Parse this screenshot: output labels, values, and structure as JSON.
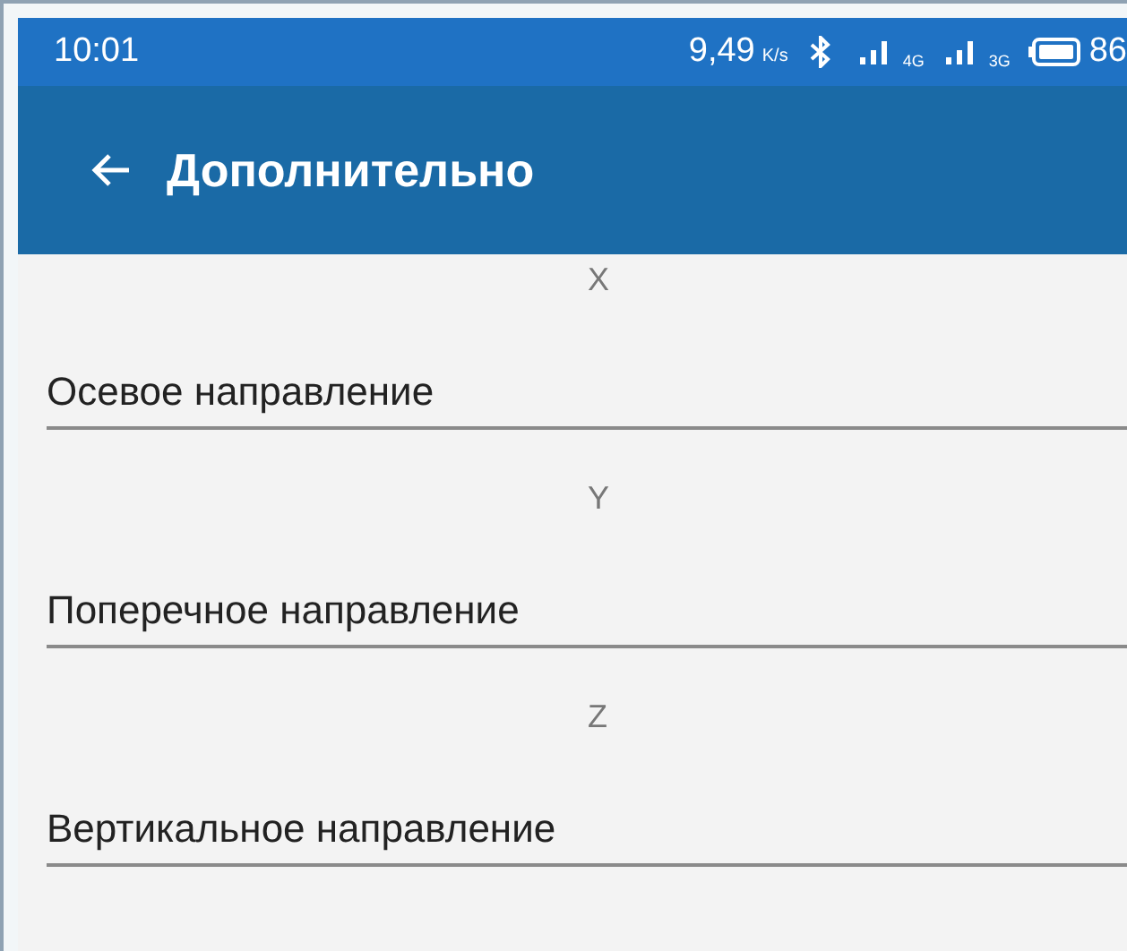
{
  "status_bar": {
    "time": "10:01",
    "speed": "9,49",
    "speed_unit": "K/s",
    "networks": [
      "4G",
      "3G"
    ],
    "battery": "86"
  },
  "app_bar": {
    "title": "Дополнительно"
  },
  "fields": [
    {
      "label": "X",
      "value": "Осевое направление"
    },
    {
      "label": "Y",
      "value": "Поперечное направление"
    },
    {
      "label": "Z",
      "value": "Вертикальное направление"
    }
  ]
}
